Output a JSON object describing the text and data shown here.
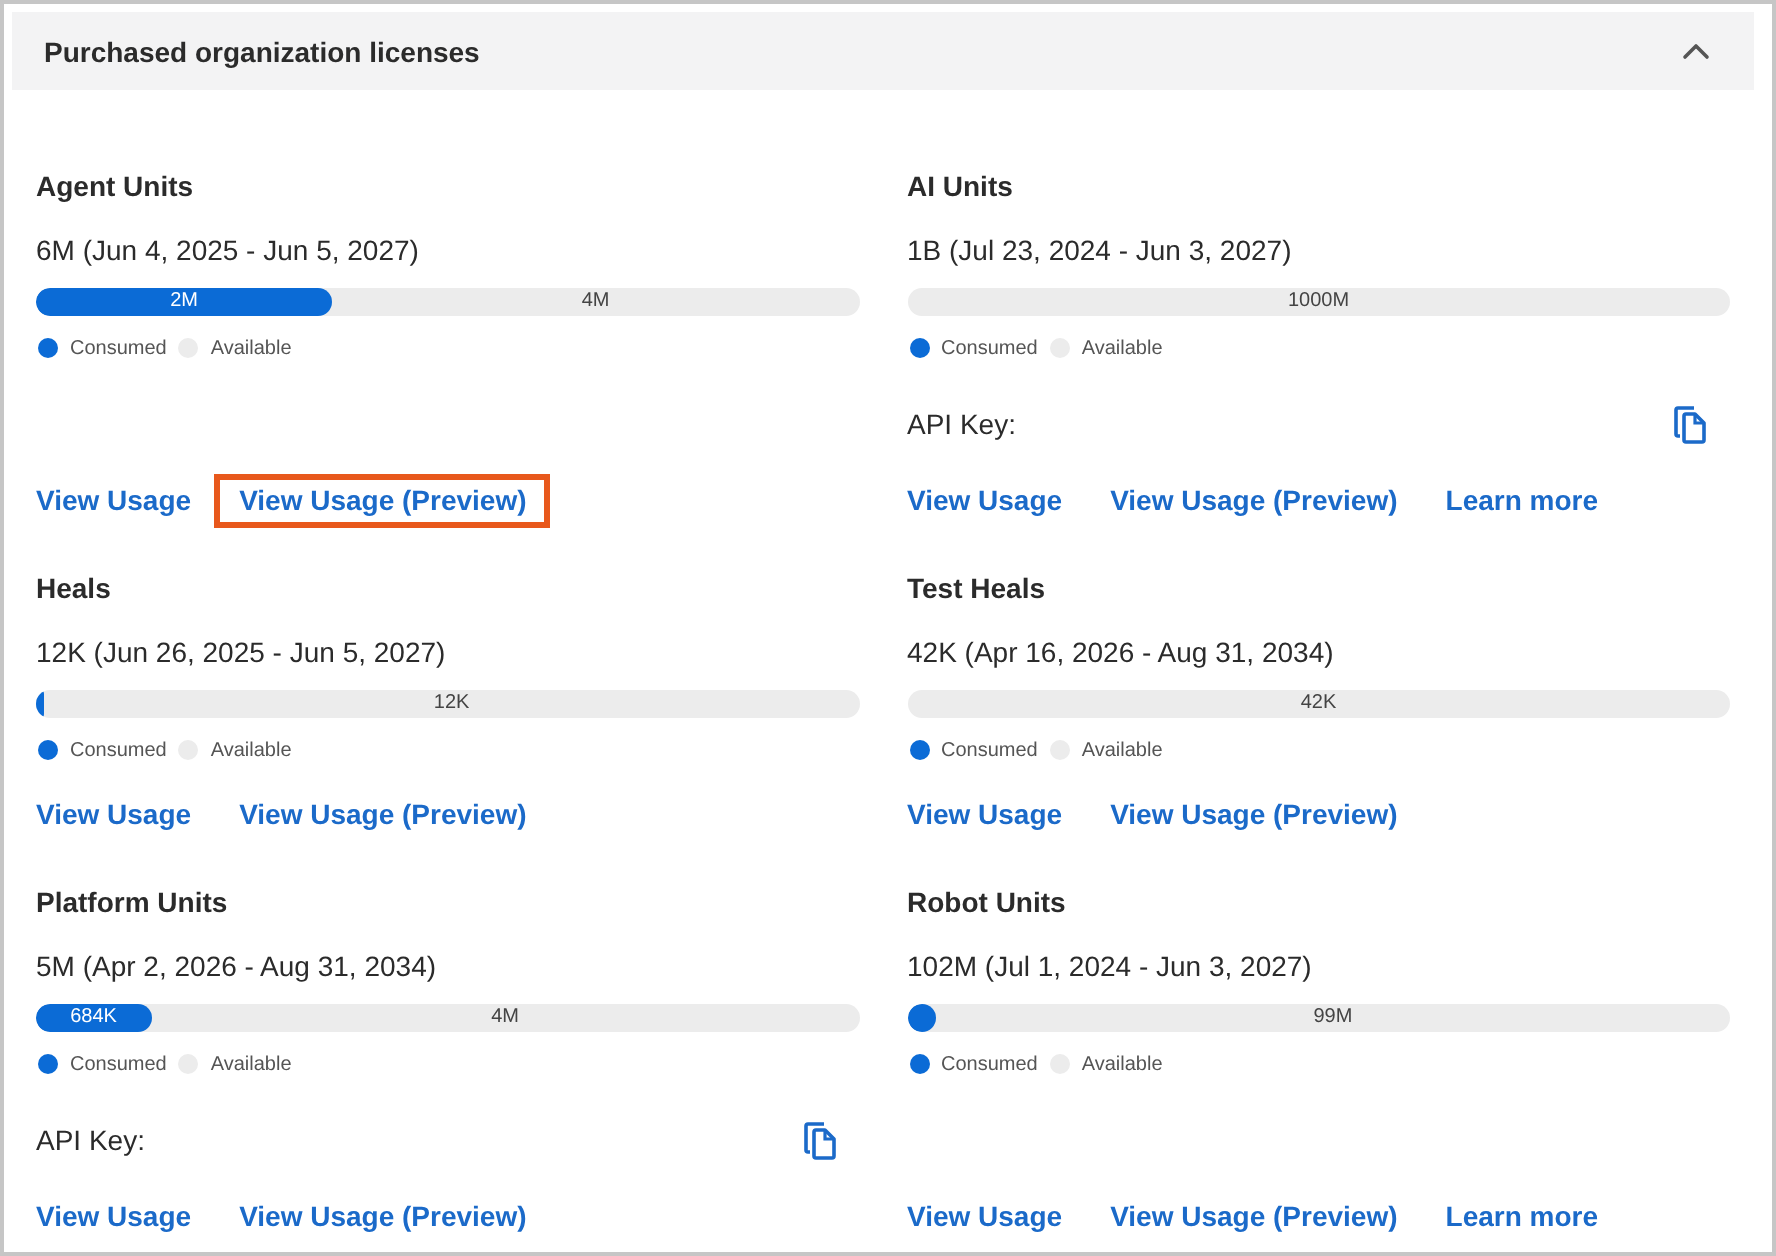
{
  "section": {
    "title": "Purchased organization licenses",
    "expanded": true
  },
  "licenses": [
    {
      "name": "Agent Units",
      "summary": "6M (Jun 4, 2025 - Jun 5, 2027)",
      "bar": {
        "level": 0.36,
        "consumed_label": "2M",
        "available_label": "4M"
      },
      "legend": [
        {
          "label": "Consumed",
          "color": "#0b6bd6"
        },
        {
          "label": "Available",
          "color": "#ececec"
        }
      ],
      "links": [
        {
          "label": "View Usage",
          "highlighted": false
        },
        {
          "label": "View Usage (Preview)",
          "highlighted": true
        }
      ]
    },
    {
      "name": "AI Units",
      "summary": "1B (Jul 23, 2024 - Jun 3, 2027)",
      "bar": {
        "level": 0,
        "available_label": "1000M"
      },
      "legend": [
        {
          "label": "Consumed",
          "color": "#0b6bd6"
        },
        {
          "label": "Available",
          "color": "#ececec"
        }
      ],
      "api_key": {
        "label": "API Key:"
      },
      "links": [
        {
          "label": "View Usage",
          "highlighted": false
        },
        {
          "label": "View Usage (Preview)",
          "highlighted": false
        },
        {
          "label": "Learn more",
          "highlighted": false
        }
      ]
    },
    {
      "name": "Heals",
      "summary": "12K (Jun 26, 2025 - Jun 5, 2027)",
      "bar": {
        "level": 0.01,
        "available_label": "12K"
      },
      "legend": [
        {
          "label": "Consumed",
          "color": "#0b6bd6"
        },
        {
          "label": "Available",
          "color": "#ececec"
        }
      ],
      "links": [
        {
          "label": "View Usage",
          "highlighted": false
        },
        {
          "label": "View Usage (Preview)",
          "highlighted": false
        }
      ]
    },
    {
      "name": "Test Heals",
      "summary": "42K (Apr 16, 2026 - Aug 31, 2034)",
      "bar": {
        "level": 0,
        "available_label": "42K"
      },
      "legend": [
        {
          "label": "Consumed",
          "color": "#0b6bd6"
        },
        {
          "label": "Available",
          "color": "#ececec"
        }
      ],
      "links": [
        {
          "label": "View Usage",
          "highlighted": false
        },
        {
          "label": "View Usage (Preview)",
          "highlighted": false
        }
      ]
    },
    {
      "name": "Platform Units",
      "summary": "5M (Apr 2, 2026 - Aug 31, 2034)",
      "bar": {
        "level": 0.14,
        "consumed_label": "684K",
        "available_label": "4M"
      },
      "legend": [
        {
          "label": "Consumed",
          "color": "#0b6bd6"
        },
        {
          "label": "Available",
          "color": "#ececec"
        }
      ],
      "api_key": {
        "label": "API Key:"
      },
      "links": [
        {
          "label": "View Usage",
          "highlighted": false
        },
        {
          "label": "View Usage (Preview)",
          "highlighted": false
        }
      ]
    },
    {
      "name": "Robot Units",
      "summary": "102M (Jul 1, 2024 - Jun 3, 2027)",
      "bar": {
        "level": 0.035,
        "available_label": "99M"
      },
      "legend": [
        {
          "label": "Consumed",
          "color": "#0b6bd6"
        },
        {
          "label": "Available",
          "color": "#ececec"
        }
      ],
      "links": [
        {
          "label": "View Usage",
          "highlighted": false
        },
        {
          "label": "View Usage (Preview)",
          "highlighted": false
        },
        {
          "label": "Learn more",
          "highlighted": false
        }
      ]
    }
  ]
}
